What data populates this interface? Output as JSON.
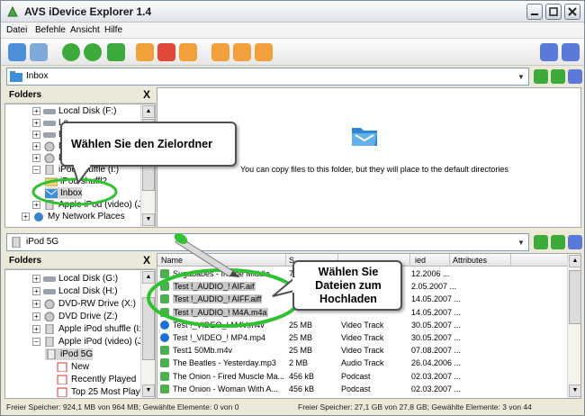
{
  "window": {
    "title": "AVS iDevice Explorer 1.4"
  },
  "menu": [
    "Datei",
    "Befehle",
    "Ansicht",
    "Hilfe"
  ],
  "toolbar_icons": [
    "search-icon",
    "refresh-icon",
    "back-icon",
    "forward-icon",
    "new-folder-icon",
    "delete-icon",
    "rename-icon",
    "copy-to-icon",
    "move-to-icon",
    "properties-icon",
    "home-icon",
    "help-icon"
  ],
  "top_address": {
    "value": "Inbox"
  },
  "bottom_address": {
    "value": "iPod 5G"
  },
  "top_pane": {
    "header": "Folders",
    "close": "X",
    "tree": [
      "Local Disk (F:)",
      "Local Disk (G:)",
      "Local Disk (H:)",
      "DVD-RW Drive (X:)",
      "DVD Drive (Z:)",
      "Apple iPod shuffle (I:)",
      "iPod shuffle",
      "Inbox",
      "Apple iPod (video) (J:)",
      "My Network Places"
    ],
    "tree_visible": [
      "Local Disk (F:)",
      "Lo",
      "Lo",
      "D",
      "D",
      "iPod shuffle (I:)",
      "iPod shuffl2",
      "Inbox",
      "Apple iPod (video) (J:)",
      "My Network Places"
    ],
    "empty_message": "You can copy files to this folder, but they will place to the default directories"
  },
  "bottom_pane": {
    "header": "Folders",
    "close": "X",
    "tree": [
      "Local Disk (G:)",
      "Local Disk (H:)",
      "DVD-RW Drive (X:)",
      "DVD Drive (Z:)",
      "Apple iPod shuffle (I:)",
      "Apple iPod (video) (J:)",
      "iPod 5G",
      "New",
      "Recently Played",
      "Top 25 Most Played"
    ],
    "columns": [
      "Name",
      "S",
      "",
      "",
      "ied",
      "Attributes"
    ],
    "files": [
      {
        "name": "Sugababes - In The Middle...",
        "size": "7",
        "type": "",
        "date": "12.2006 ..."
      },
      {
        "name": "Test !_AUDIO_!  AIF.aif",
        "size": "6",
        "type": "",
        "date": "2.05.2007 ..."
      },
      {
        "name": "Test !_AUDIO_!  AIFF.aiff",
        "size": "",
        "type": "",
        "date": "14.05.2007 ..."
      },
      {
        "name": "Test !_AUDIO_!  M4A.m4a",
        "size": "",
        "type": "",
        "date": "14.05.2007 ..."
      },
      {
        "name": "Test !_VIDEO_!  M4V.m4v",
        "size": "25 MB",
        "type": "Video Track",
        "date": "30.05.2007 ..."
      },
      {
        "name": "Test !_VIDEO_!  MP4.mp4",
        "size": "25 MB",
        "type": "Video Track",
        "date": "30.05.2007 ..."
      },
      {
        "name": "Test1 50Mb.m4v",
        "size": "25 MB",
        "type": "Video Track",
        "date": "07.08.2007 ..."
      },
      {
        "name": "The Beatles - Yesterday.mp3",
        "size": "2 MB",
        "type": "Audio Track",
        "date": "26.04.2006 ..."
      },
      {
        "name": "The Onion - Fired Muscle Ma...",
        "size": "456 kB",
        "type": "Podcast",
        "date": "02.03.2007 ..."
      },
      {
        "name": "The Onion - Woman With A...",
        "size": "456 kB",
        "type": "Podcast",
        "date": "02.03.2007 ..."
      }
    ]
  },
  "status_left": "Freier Speicher: 924,1 MB von 964 MB;  Gewählte Elemente: 0 von 0",
  "status_right": "Freier Speicher: 27,1 GB von 27,8 GB;  Gewählte Elemente: 3 von 44",
  "callouts": {
    "target": "Wählen Sie den Zielordner",
    "upload": "Wählen Sie Dateien zum Hochladen"
  },
  "colors": {
    "highlight_green": "#2fc12f",
    "selection": "#c8c8c8",
    "folder_blue": "#3c8fd6"
  }
}
